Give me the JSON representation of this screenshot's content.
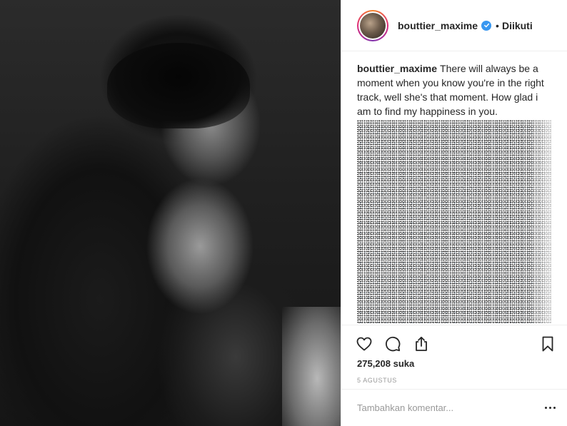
{
  "post": {
    "image_alt": "Black and white photo of a couple embracing",
    "author": {
      "username": "bouttier_maxime",
      "verified": true,
      "follow_status": "Diikuti",
      "separator": "•"
    },
    "caption": {
      "username": "bouttier_maxime",
      "text": "There will always be a moment when you know you're in the right track, well she's that moment. How glad i am to find my happiness in you."
    },
    "likes_label": "275,208 suka",
    "date_label": "5 AGUSTUS",
    "comment_placeholder": "Tambahkan komentar..."
  },
  "icons": {
    "like": "heart-icon",
    "comment": "comment-bubble-icon",
    "share": "share-icon",
    "save": "bookmark-icon",
    "more": "more-options-icon",
    "verified": "verified-badge-icon"
  },
  "colors": {
    "verified": "#3897f0",
    "border": "#efefef",
    "text": "#262626",
    "muted": "#999999"
  }
}
